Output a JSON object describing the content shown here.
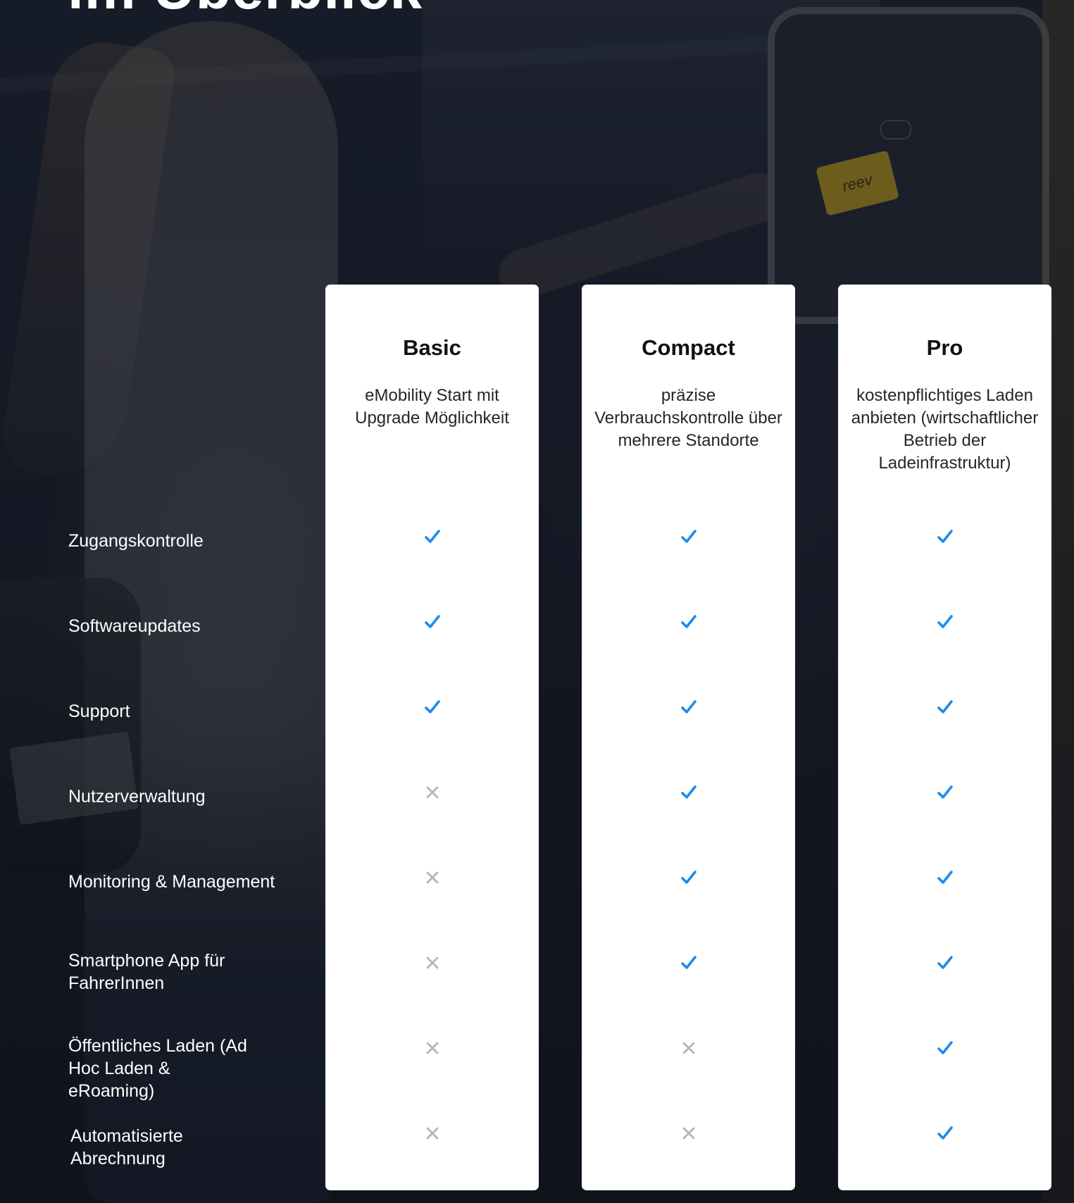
{
  "heading": "im Überblick",
  "features": [
    "Zugangskontrolle",
    "Softwareupdates",
    "Support",
    "Nutzerverwaltung",
    "Monitoring & Management",
    "Smartphone App für FahrerInnen",
    "Öffentliches Laden (Ad Hoc Laden & eRoaming)",
    "Automatisierte Abrechnung"
  ],
  "plans": [
    {
      "name": "Basic",
      "description": "eMobility Start mit Upgrade Möglichkeit",
      "features": [
        true,
        true,
        true,
        false,
        false,
        false,
        false,
        false
      ]
    },
    {
      "name": "Compact",
      "description": "präzise Verbrauchskontrolle über mehrere Standorte",
      "features": [
        true,
        true,
        true,
        true,
        true,
        true,
        false,
        false
      ]
    },
    {
      "name": "Pro",
      "description": "kostenpflichtiges Laden anbieten (wirtschaftlicher Betrieb der Ladeinfrastruktur)",
      "features": [
        true,
        true,
        true,
        true,
        true,
        true,
        true,
        true
      ]
    }
  ],
  "background_card_text": "reev",
  "colors": {
    "check": "#1a8cf0",
    "cross": "#b5b5b5"
  },
  "icons": {
    "included": "check-icon",
    "excluded": "cross-icon"
  }
}
